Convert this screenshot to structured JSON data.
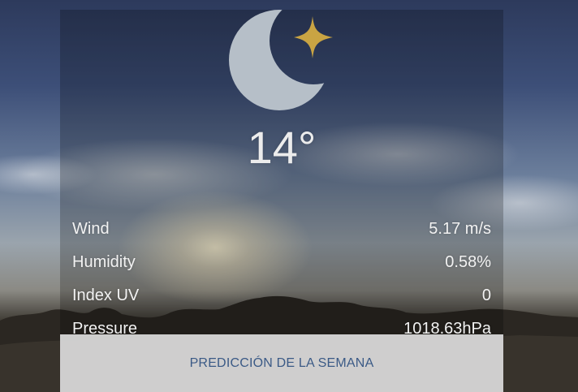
{
  "weather": {
    "temperature": "14°",
    "icon": "moon-star-icon",
    "icon_colors": {
      "moon": "#b6bfc8",
      "star": "#c9a443"
    }
  },
  "details": [
    {
      "label": "Wind",
      "value": "5.17 m/s"
    },
    {
      "label": "Humidity",
      "value": "0.58%"
    },
    {
      "label": "Index UV",
      "value": "0"
    },
    {
      "label": "Pressure",
      "value": "1018.63hPa"
    }
  ],
  "forecast": {
    "button_label": "PREDICCIÓN DE LA SEMANA",
    "text_color": "#3b5a86"
  }
}
